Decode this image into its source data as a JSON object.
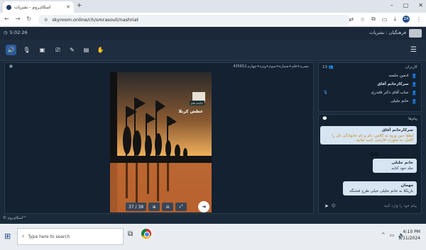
{
  "browser": {
    "tab_title": "اسکای‌روم - نشریات",
    "url": "skyroom.online/ch/smrasouli/nashriat",
    "profile_initial": "ZA"
  },
  "header": {
    "timer": "5:02:26",
    "room_title": "فرهنگیان : نشریات"
  },
  "document": {
    "filename": "نشریه+قلم+شماره+سوم+ویژه+چهارم.435652",
    "page_title": "عطش کربلا",
    "page_subtitle": "جامعه قلم",
    "page_indicator": "37 / 38",
    "colors": {
      "sky_top": "#f2b15c",
      "sky_bottom": "#c66a33"
    }
  },
  "users": {
    "title": "کاربران",
    "count": "13",
    "list": [
      {
        "name": "ادمین جلسه"
      },
      {
        "name": "سرکارخانم آفاق"
      },
      {
        "name": "جناب آقای دکتر قلندری"
      },
      {
        "name": "خانم جلیلی"
      }
    ]
  },
  "messages": {
    "title": "پیام‌ها",
    "items": [
      {
        "name": "سرکارخانم آفاق",
        "text": "لطفا حین ورود به کلاس، نام و نام خانوادگی تان را کامل، به صورت فارسی تایپ نمایید."
      },
      {
        "name": "خانم جلیلی",
        "text": "جلد خود کتابه"
      },
      {
        "name": "مهمان",
        "text": "باریکلا به خانم جلیلی خیلی طرح قشنگه"
      }
    ],
    "emoji": "😊😊",
    "input_placeholder": "پیام خود را وارد کنید"
  },
  "footer": {
    "brand": "© اسکای‌روم™"
  },
  "taskbar": {
    "search_placeholder": "Type here to search",
    "time": "6:10 PM",
    "date": "9/11/2024"
  }
}
